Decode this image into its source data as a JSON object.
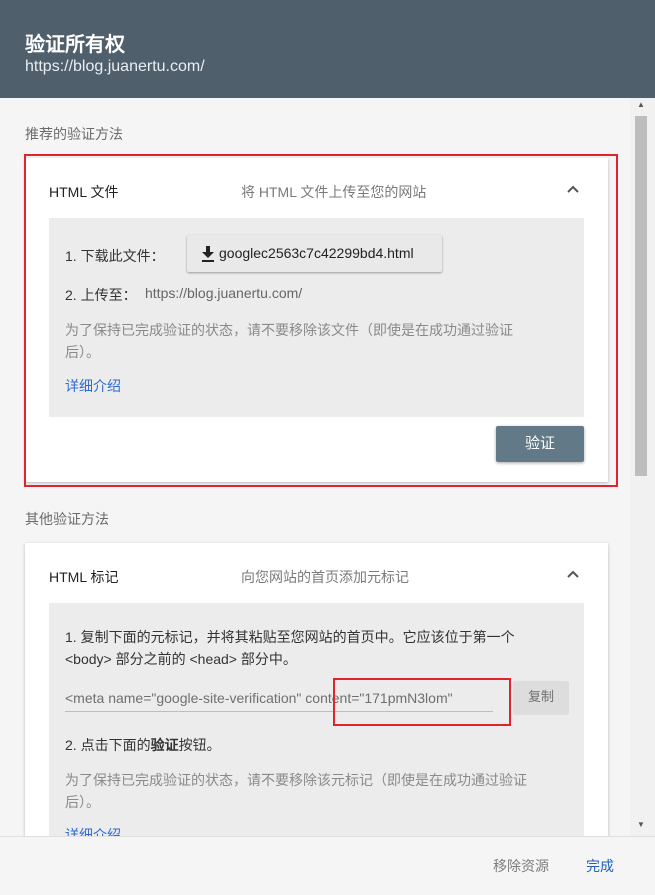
{
  "dialog": {
    "title": "验证所有权",
    "url": "https://blog.juanertu.com/"
  },
  "recommended": {
    "section_label": "推荐的验证方法",
    "card": {
      "name": "HTML 文件",
      "description": "将 HTML 文件上传至您的网站",
      "step1_label": "1. 下载此文件：",
      "download_file": "googlec2563c7c42299bd4.html",
      "step2_label": "2. 上传至：",
      "step2_url": "https://blog.juanertu.com/",
      "note_line1": "为了保持已完成验证的状态，请不要移除该文件（即使是在成功通过验证",
      "note_line2": "后）。",
      "learn_more": "详细介绍",
      "verify_button": "验证"
    }
  },
  "other": {
    "section_label": "其他验证方法",
    "card": {
      "name": "HTML 标记",
      "description": "向您网站的首页添加元标记",
      "step1_bold": "1. 复制下面的元标记，并将其粘贴至您网站的首页中。它应该位于第一个",
      "step1_line2": "<body> 部分之前的 <head> 部分中。",
      "meta_value": "<meta name=\"google-site-verification\" content=\"171pmN3lom\"",
      "copy_button": "复制",
      "step2_prefix": "2. 点击下面的",
      "step2_bold": "验证",
      "step2_suffix": "按钮。",
      "note_line1": "为了保持已完成验证的状态，请不要移除该元标记（即使是在成功通过验证",
      "note_line2": "后）。",
      "learn_more": "详细介绍"
    }
  },
  "footer": {
    "remove_resource": "移除资源",
    "done": "完成"
  },
  "colors": {
    "header_bg": "#4f5f6b",
    "verify_button_bg": "#627988",
    "highlight_red": "#e0232d",
    "link_blue": "#2f6bd5"
  }
}
